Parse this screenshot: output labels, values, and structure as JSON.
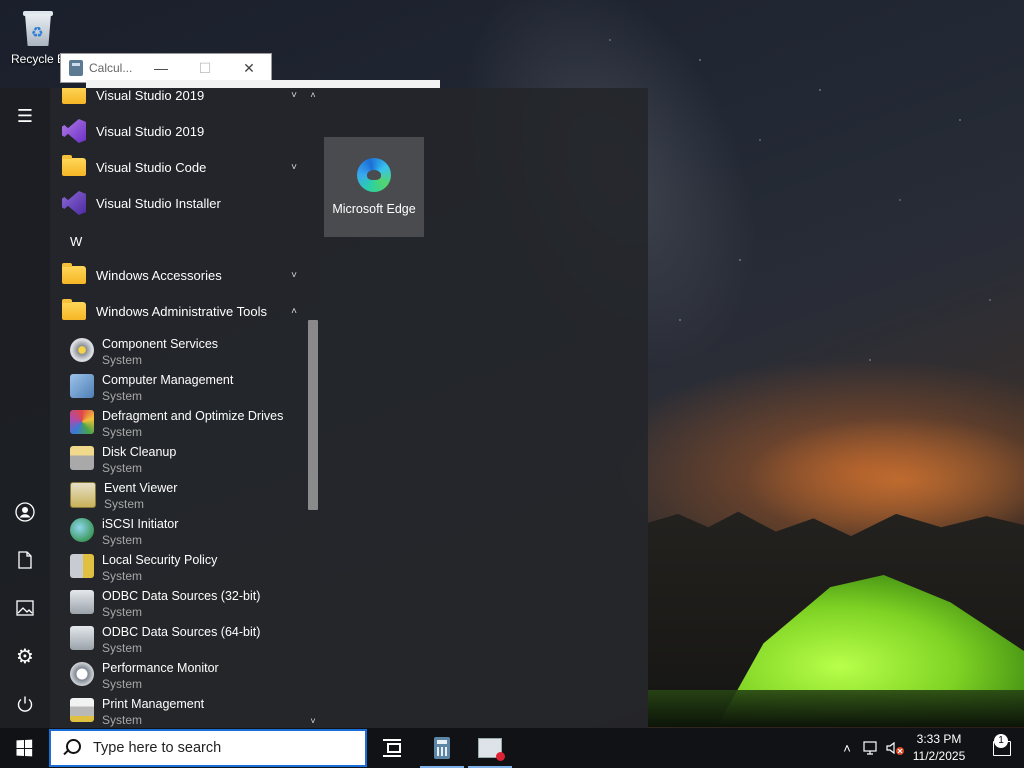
{
  "desktop": {
    "recycle_bin_label": "Recycle B"
  },
  "calculator_window": {
    "title": "Calcul...",
    "minimize_glyph": "—",
    "maximize_glyph": "☐",
    "close_glyph": "✕"
  },
  "start_menu": {
    "rail": {
      "menu_icon": "hamburger-icon",
      "account_icon": "user-icon",
      "documents_icon": "document-icon",
      "pictures_icon": "picture-icon",
      "settings_icon": "gear-icon",
      "power_icon": "power-icon"
    },
    "apps": [
      {
        "label": "Visual Studio 2019",
        "icon": "folder-icon",
        "chevron": "˅"
      },
      {
        "label": "Visual Studio 2019",
        "icon": "visual-studio-icon"
      },
      {
        "label": "Visual Studio Code",
        "icon": "folder-icon",
        "chevron": "˅"
      },
      {
        "label": "Visual Studio Installer",
        "icon": "visual-studio-installer-icon"
      }
    ],
    "letter_w": "W",
    "w_folders": [
      {
        "label": "Windows Accessories",
        "chevron": "˅"
      },
      {
        "label": "Windows Administrative Tools",
        "chevron": "˄"
      }
    ],
    "admin_tools": [
      {
        "name": "Component Services",
        "category": "System",
        "color": "#8a8f96"
      },
      {
        "name": "Computer Management",
        "category": "System",
        "color": "#4f7fb5"
      },
      {
        "name": "Defragment and Optimize Drives",
        "category": "System",
        "color": "#b04aa8"
      },
      {
        "name": "Disk Cleanup",
        "category": "System",
        "color": "#a9a9a9"
      },
      {
        "name": "Event Viewer",
        "category": "System",
        "color": "#c9b25a"
      },
      {
        "name": "iSCSI Initiator",
        "category": "System",
        "color": "#3f9a5e"
      },
      {
        "name": "Local Security Policy",
        "category": "System",
        "color": "#8e949c"
      },
      {
        "name": "ODBC Data Sources (32-bit)",
        "category": "System",
        "color": "#9aa2aa"
      },
      {
        "name": "ODBC Data Sources (64-bit)",
        "category": "System",
        "color": "#9aa2aa"
      },
      {
        "name": "Performance Monitor",
        "category": "System",
        "color": "#7e8690"
      },
      {
        "name": "Print Management",
        "category": "System",
        "color": "#b8b8b8"
      }
    ],
    "scroll": {
      "up": "˄",
      "down": "˅"
    },
    "tiles": [
      {
        "label": "Microsoft Edge",
        "icon": "edge-icon"
      }
    ]
  },
  "taskbar": {
    "search_placeholder": "Type here to search",
    "tray_chevron": "˄",
    "clock_time": "3:33 PM",
    "clock_date": "11/2/2025",
    "notification_count": "1"
  }
}
